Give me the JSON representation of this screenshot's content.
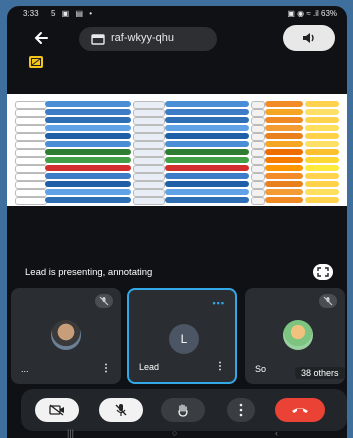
{
  "status_bar": {
    "time": "3:33",
    "icons": "5 ▣ ▤ •",
    "right": "▣ ◉ ≈ .il 63%"
  },
  "header": {
    "meeting_code": "raf-wkyy-qhu"
  },
  "presentation": {
    "status_text": "Lead is presenting, annotating"
  },
  "participants": [
    {
      "name": "...",
      "avatar": "photo",
      "muted": true
    },
    {
      "name": "Lead",
      "initial": "L",
      "muted": false,
      "active": true
    },
    {
      "name": "So",
      "avatar": "avatar",
      "muted": true
    }
  ],
  "others": "38 others",
  "colors": {
    "accent": "#33a8e6",
    "end_call": "#ea4335",
    "tile_bg": "#2a2d31"
  },
  "controls": [
    "camera-off-icon",
    "mic-off-icon",
    "raise-hand-icon",
    "more-options-icon",
    "end-call-icon"
  ]
}
